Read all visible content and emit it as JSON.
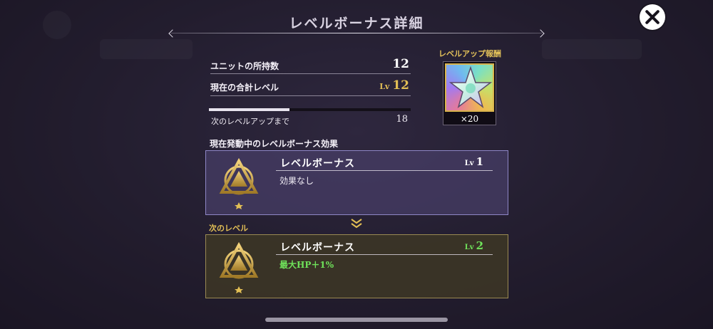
{
  "screen": {
    "title": "レベルボーナス詳細"
  },
  "stats": {
    "units_owned_label": "ユニットの所持数",
    "units_owned_value": "12",
    "total_level_label": "現在の合計レベル",
    "total_level_prefix": "Lv",
    "total_level_value": "12",
    "next_levelup_label": "次のレベルアップまで",
    "next_levelup_value": "18",
    "progress_fraction": 0.4
  },
  "reward": {
    "title": "レベルアップ報酬",
    "count": "×20",
    "icon": "rainbow-star-icon"
  },
  "active": {
    "section_label": "現在発動中のレベルボーナス効果",
    "name": "レベルボーナス",
    "lv_prefix": "Lv",
    "lv_value": "1",
    "effect": "効果なし",
    "icon": "triangle-emblem-icon"
  },
  "next": {
    "section_label": "次のレベル",
    "name": "レベルボーナス",
    "lv_prefix": "Lv",
    "lv_value": "2",
    "effect": "最大HP＋1%",
    "icon": "triangle-emblem-icon"
  },
  "colors": {
    "gold": "#e2bf55",
    "green": "#6fe25a",
    "active_border": "#8e86c6",
    "next_border": "#9a8a52"
  }
}
